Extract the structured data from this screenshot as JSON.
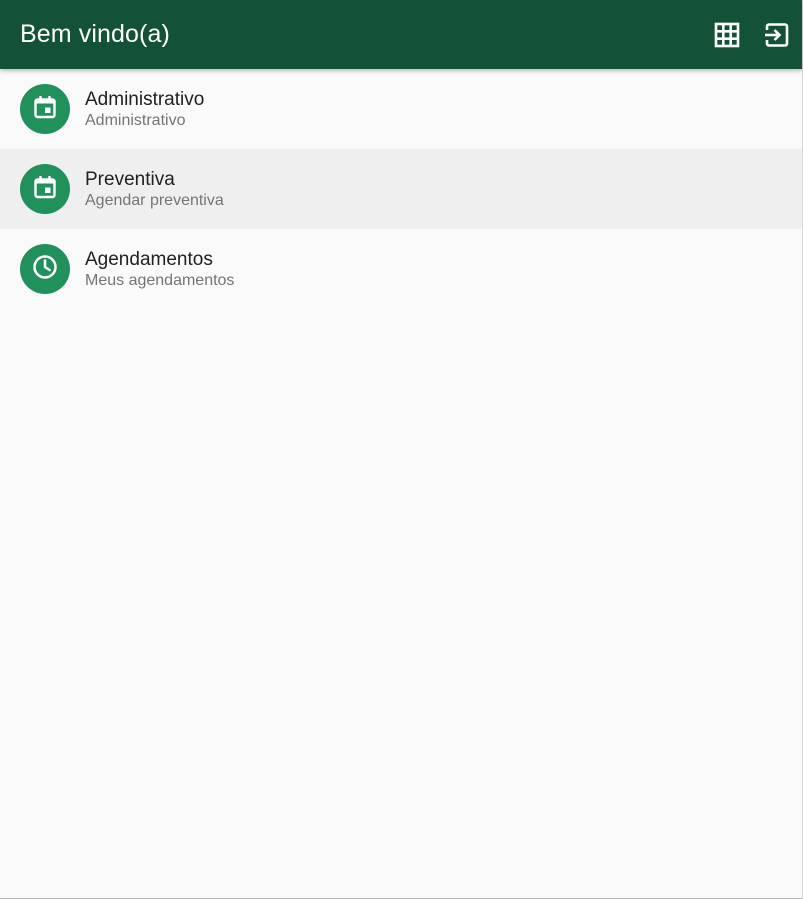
{
  "appbar": {
    "title": "Bem vindo(a)",
    "background": "#135237",
    "actions": [
      {
        "icon": "grid-icon"
      },
      {
        "icon": "logout-icon"
      }
    ]
  },
  "menu": {
    "items": [
      {
        "title": "Administrativo",
        "subtitle": "Administrativo",
        "icon": "calendar-event-icon"
      },
      {
        "title": "Preventiva",
        "subtitle": "Agendar preventiva",
        "icon": "calendar-event-icon"
      },
      {
        "title": "Agendamentos",
        "subtitle": "Meus agendamentos",
        "icon": "clock-icon"
      }
    ],
    "accent": "#21915c"
  }
}
